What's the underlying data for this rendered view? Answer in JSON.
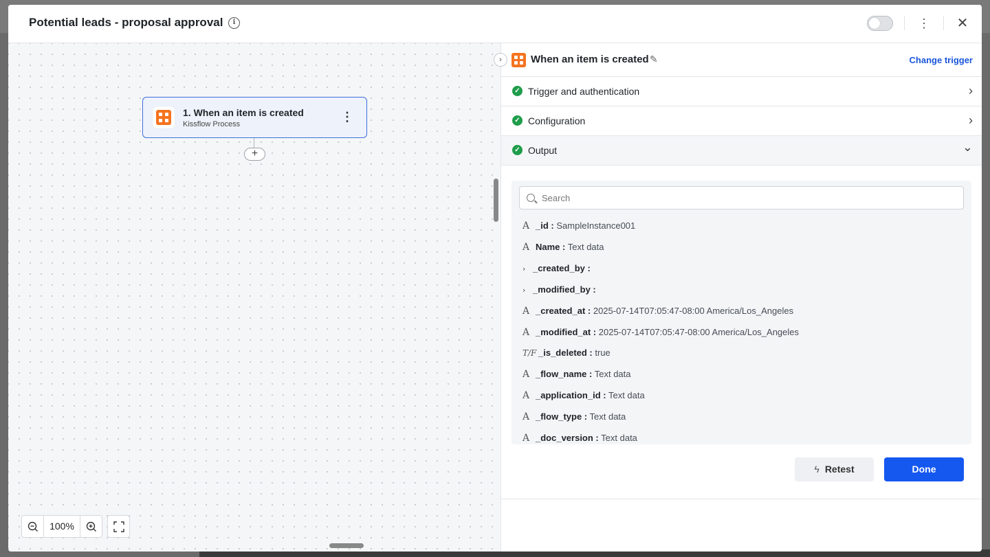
{
  "header": {
    "title": "Potential leads - proposal approval",
    "info_icon": "i",
    "kebab": "⋮",
    "close": "✕"
  },
  "canvas": {
    "node": {
      "title": "1. When an item is created",
      "subtitle": "Kissflow Process",
      "menu": "⋮"
    },
    "add_node": "+",
    "zoom": {
      "zoom_out": "−",
      "value": "100%",
      "zoom_in": "+"
    }
  },
  "panel": {
    "title": "When an item is created",
    "edit_icon": "✎",
    "change_trigger": "Change trigger",
    "collapse": "›",
    "sections": [
      {
        "label": "Trigger and authentication",
        "chevron": "›"
      },
      {
        "label": "Configuration",
        "chevron": "›"
      },
      {
        "label": "Output",
        "chevron": "⌄"
      }
    ],
    "check": "✓",
    "search_placeholder": "Search",
    "fields": [
      {
        "icon": "A",
        "key": "_id :",
        "value": "SampleInstance001"
      },
      {
        "icon": "A",
        "key": "Name :",
        "value": "Text data"
      },
      {
        "icon": "›",
        "key": "_created_by :",
        "value": ""
      },
      {
        "icon": "›",
        "key": "_modified_by :",
        "value": ""
      },
      {
        "icon": "A",
        "key": "_created_at :",
        "value": "2025-07-14T07:05:47-08:00 America/Los_Angeles"
      },
      {
        "icon": "A",
        "key": "_modified_at :",
        "value": "2025-07-14T07:05:47-08:00 America/Los_Angeles"
      },
      {
        "icon": "T/F",
        "key": "_is_deleted :",
        "value": "true"
      },
      {
        "icon": "A",
        "key": "_flow_name :",
        "value": "Text data"
      },
      {
        "icon": "A",
        "key": "_application_id :",
        "value": "Text data"
      },
      {
        "icon": "A",
        "key": "_flow_type :",
        "value": "Text data"
      },
      {
        "icon": "A",
        "key": "_doc_version :",
        "value": "Text data"
      }
    ],
    "retest_label": "Retest",
    "retest_icon": "ϟ",
    "done_label": "Done"
  },
  "colors": {
    "accent": "#1558f0",
    "brand_orange": "#f5731f",
    "success": "#1f9d4b"
  }
}
